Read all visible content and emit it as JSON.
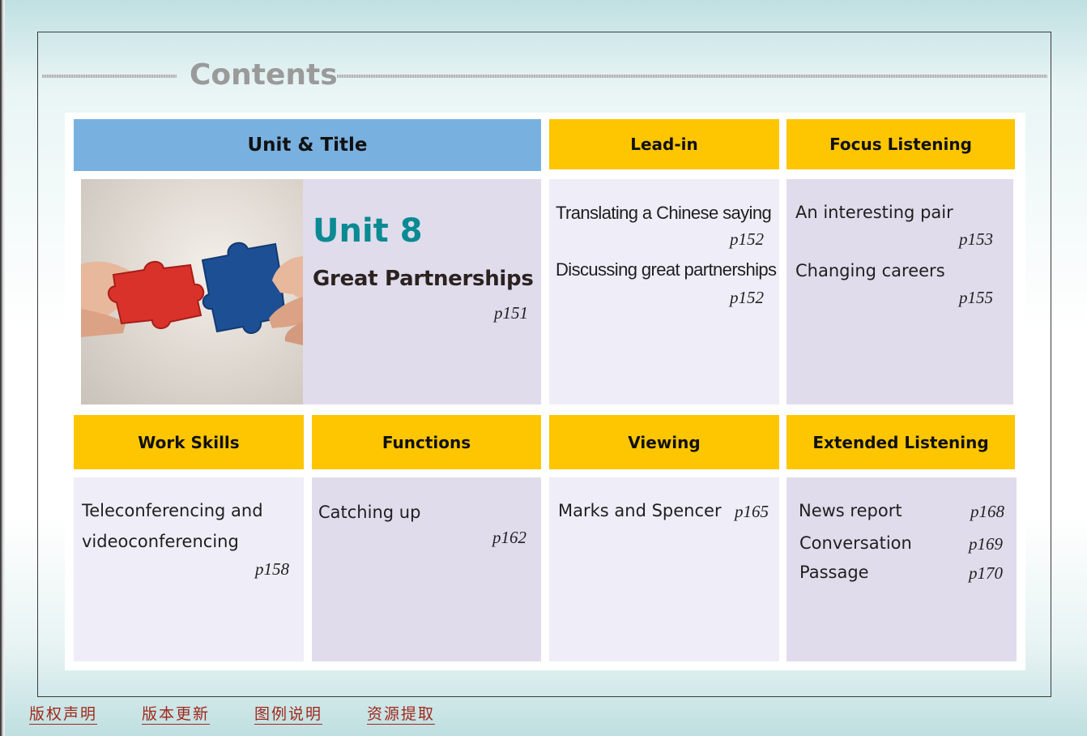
{
  "heading": {
    "title": "Contents"
  },
  "headers": {
    "unit_title": "Unit & Title",
    "lead_in": "Lead-in",
    "focus_listening": "Focus Listening",
    "work_skills": "Work Skills",
    "functions": "Functions",
    "viewing": "Viewing",
    "extended_listening": "Extended Listening"
  },
  "unit": {
    "number": "Unit 8",
    "title": "Great Partnerships",
    "page": "p151"
  },
  "lead_in": {
    "items": [
      {
        "title": "Translating a Chinese saying",
        "page": "p152"
      },
      {
        "title": "Discussing great partnerships",
        "page": "p152"
      }
    ]
  },
  "focus_listening": {
    "items": [
      {
        "title": "An interesting pair",
        "page": "p153"
      },
      {
        "title": "Changing careers",
        "page": "p155"
      }
    ]
  },
  "work_skills": {
    "line1": "Teleconferencing and",
    "line2": "videoconferencing",
    "page": "p158"
  },
  "functions": {
    "title": "Catching up",
    "page": "p162"
  },
  "viewing": {
    "title": "Marks and Spencer",
    "page": "p165"
  },
  "extended_listening": {
    "items": [
      {
        "title": "News report",
        "page": "p168"
      },
      {
        "title": "Conversation",
        "page": "p169"
      },
      {
        "title": "Passage",
        "page": "p170"
      }
    ]
  },
  "footer": {
    "copyright": "版权声明",
    "version": "版本更新",
    "legend": "图例说明",
    "resources": "资源提取"
  },
  "colors": {
    "header_blue": "#78b1e0",
    "header_yellow": "#fdc600",
    "unit_teal": "#0a8a92",
    "footer_link": "#a0281c"
  }
}
